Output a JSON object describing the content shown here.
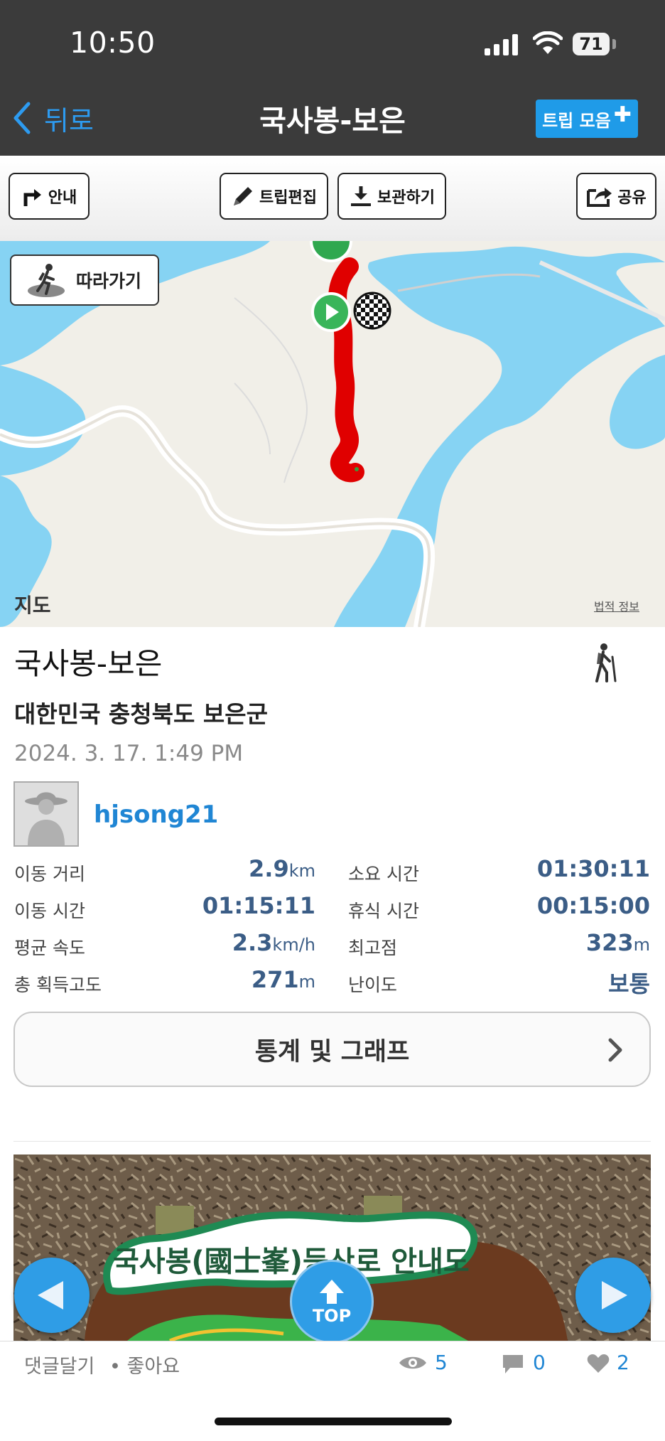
{
  "status_bar": {
    "time": "10:50",
    "battery": "71"
  },
  "header": {
    "back_label": "뒤로",
    "title": "국사봉-보은",
    "trip_button_label": "트립 모음"
  },
  "toolbar": {
    "guide": "안내",
    "edit": "트립편집",
    "save": "보관하기",
    "share": "공유"
  },
  "map": {
    "follow_label": "따라가기",
    "map_brand": "지도",
    "legal_label": "법적 정보",
    "route_color": "#e00000"
  },
  "trip": {
    "name": "국사봉-보은",
    "region": "대한민국 충청북도 보은군",
    "datetime": "2024. 3. 17. 1:49 PM",
    "username": "hjsong21",
    "activity_icon": "hiker-icon"
  },
  "stats": {
    "distance_label": "이동 거리",
    "distance_value": "2.9",
    "distance_unit": "km",
    "total_time_label": "소요 시간",
    "total_time_value": "01:30:11",
    "moving_time_label": "이동 시간",
    "moving_time_value": "01:15:11",
    "rest_time_label": "휴식 시간",
    "rest_time_value": "00:15:00",
    "avg_speed_label": "평균 속도",
    "avg_speed_value": "2.3",
    "avg_speed_unit": "km/h",
    "max_alt_label": "최고점",
    "max_alt_value": "323",
    "max_alt_unit": "m",
    "gain_label": "총 획득고도",
    "gain_value": "271",
    "gain_unit": "m",
    "difficulty_label": "난이도",
    "difficulty_value": "보통"
  },
  "graph_button": {
    "label": "통계 및 그래프"
  },
  "photo": {
    "sign_text": "국사봉(國士峯)등산로 안내도",
    "top_label": "TOP"
  },
  "footer": {
    "comment_label": "댓글달기",
    "like_label": "• 좋아요",
    "views": "5",
    "comments": "0",
    "likes": "2"
  },
  "colors": {
    "accent": "#2086d4",
    "header_bg": "#3b3b3b",
    "stat_value": "#3b5d86",
    "water": "#86d3f3"
  }
}
